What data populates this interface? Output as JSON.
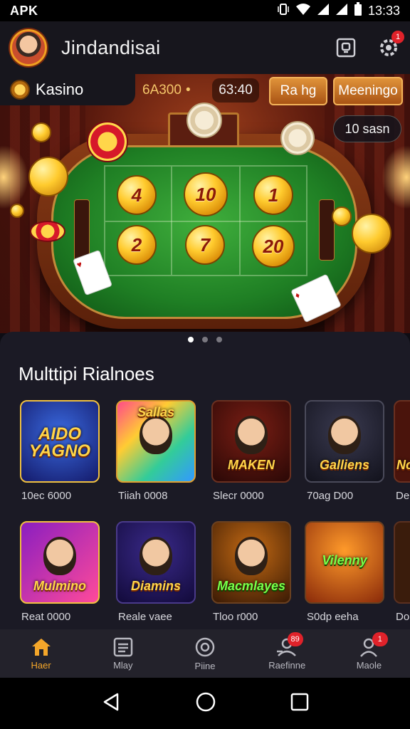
{
  "status_bar": {
    "left_text": "APK",
    "time": "13:33"
  },
  "header": {
    "app_title": "Jindandisai",
    "notification_count": "1"
  },
  "hero": {
    "tag_label": "Kasino",
    "stat_a": "6A300",
    "stat_a_arrow": "•",
    "stat_b": "63:40",
    "button_1": "Ra hg",
    "button_2": "Meeningo",
    "pill_value": "10 sasn",
    "table_numbers": [
      "4",
      "10",
      "1",
      "2",
      "7",
      "20"
    ]
  },
  "carousel": {
    "page_count": 3,
    "active_index": 0
  },
  "section": {
    "title": "Multtipi Rialnoes",
    "row1": [
      {
        "logo": "AIDO YAGNO",
        "caption": "10ec 6000",
        "theme": "blue"
      },
      {
        "logo": "Sallas",
        "caption": "Tiiah 0008",
        "theme": "rainbow"
      },
      {
        "logo": "MAKEN",
        "caption": "Slecr 0000",
        "theme": "red"
      },
      {
        "logo": "Galliens",
        "caption": "70ag D00",
        "theme": "gold"
      },
      {
        "logo": "No",
        "caption": "De",
        "theme": "red"
      }
    ],
    "row2": [
      {
        "logo": "Mulmino",
        "caption": "Reat 0000",
        "theme": "purple"
      },
      {
        "logo": "Diamins",
        "caption": "Reale vaee",
        "theme": "navy"
      },
      {
        "logo": "Macmlayes",
        "caption": "Tloo r000",
        "theme": "green"
      },
      {
        "logo": "Vilenny",
        "caption": "S0dp eeha",
        "theme": "orange"
      },
      {
        "logo": "",
        "caption": "Do",
        "theme": "brown"
      }
    ]
  },
  "bottom_nav": [
    {
      "label": "Haer",
      "icon": "home-icon",
      "active": true,
      "badge": ""
    },
    {
      "label": "Mlay",
      "icon": "list-icon",
      "active": false,
      "badge": ""
    },
    {
      "label": "Piine",
      "icon": "target-icon",
      "active": false,
      "badge": ""
    },
    {
      "label": "Raefinne",
      "icon": "support-icon",
      "active": false,
      "badge": "89"
    },
    {
      "label": "Maole",
      "icon": "user-icon",
      "active": false,
      "badge": "1"
    }
  ],
  "colors": {
    "accent": "#f4a62a",
    "badge": "#e0222a",
    "felt": "#1f7f24"
  }
}
